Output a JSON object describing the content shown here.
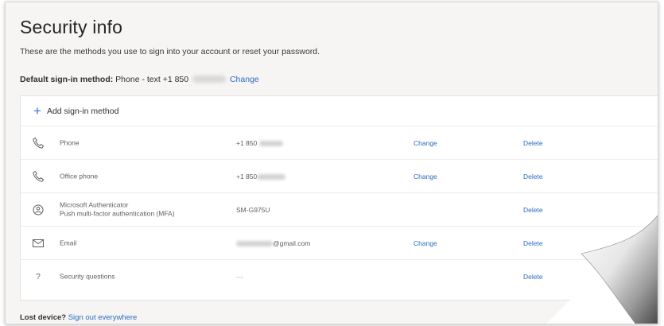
{
  "page": {
    "title": "Security info",
    "description": "These are the methods you use to sign into your account or reset your password."
  },
  "default_method": {
    "label": "Default sign-in method:",
    "value": "Phone - text +1 850",
    "change_label": "Change"
  },
  "add_method": {
    "label": "Add sign-in method",
    "icon": "plus-icon"
  },
  "methods": [
    {
      "icon": "phone-icon",
      "name": "Phone",
      "value": "+1 850",
      "redacted": true,
      "change": "Change",
      "delete": "Delete"
    },
    {
      "icon": "phone-icon",
      "name": "Office phone",
      "value": "+1 850",
      "redacted": true,
      "change": "Change",
      "delete": "Delete"
    },
    {
      "icon": "authenticator-icon",
      "name": "Microsoft Authenticator",
      "subtitle": "Push multi-factor authentication (MFA)",
      "value": "SM-G975U",
      "redacted": false,
      "change": "",
      "delete": "Delete"
    },
    {
      "icon": "mail-icon",
      "name": "Email",
      "value": "@gmail.com",
      "redacted": true,
      "change": "Change",
      "delete": "Delete"
    },
    {
      "icon": "question-icon",
      "name": "Security questions",
      "value": "---",
      "redacted": false,
      "change": "",
      "delete": "Delete"
    }
  ],
  "lost_device": {
    "label": "Lost device?",
    "link": "Sign out everywhere"
  },
  "colors": {
    "link": "#2b6cc4",
    "accent_plus": "#3a76c8",
    "background": "#f6f5f4",
    "card": "#ffffff"
  }
}
